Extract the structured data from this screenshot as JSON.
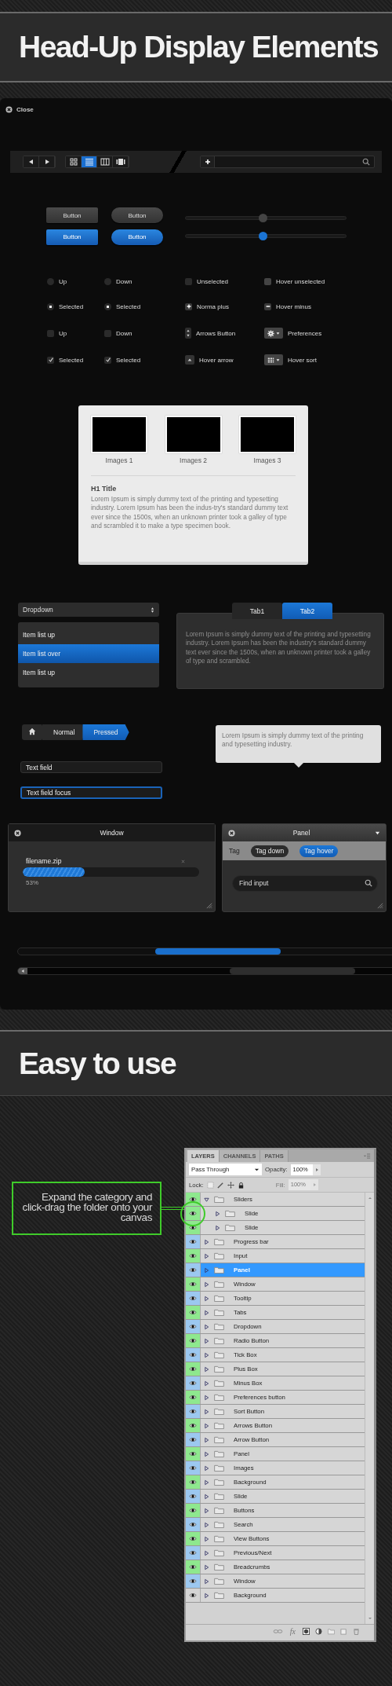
{
  "header": {
    "title": "Head-Up Display Elements"
  },
  "hud": {
    "close": "Close",
    "nav": [
      {
        "kind": "prev"
      },
      {
        "kind": "next"
      }
    ],
    "views": [
      {
        "kind": "grid",
        "selected": false
      },
      {
        "kind": "list",
        "selected": true
      },
      {
        "kind": "columns",
        "selected": false
      },
      {
        "kind": "coverflow",
        "selected": false
      }
    ],
    "buttons": [
      {
        "label": "Button",
        "kind": "square",
        "active": false
      },
      {
        "label": "Button",
        "kind": "pill",
        "active": false
      },
      {
        "label": "Button",
        "kind": "square",
        "active": true
      },
      {
        "label": "Button",
        "kind": "pill",
        "active": true
      }
    ],
    "sliders": [
      {
        "level": 0.48,
        "active": false
      },
      {
        "level": 0.48,
        "active": true
      }
    ],
    "radios": [
      {
        "label": "Up",
        "checked": false
      },
      {
        "label": "Down",
        "checked": false
      },
      {
        "label": "Selected",
        "checked": true
      },
      {
        "label": "Selected",
        "checked": true
      }
    ],
    "checkboxes": [
      {
        "label": "Up",
        "checked": false
      },
      {
        "label": "Down",
        "checked": false
      },
      {
        "label": "Selected",
        "checked": true
      },
      {
        "label": "Selected",
        "checked": true
      }
    ],
    "controls": [
      {
        "kind": "box",
        "label": "Unselected",
        "checked": false
      },
      {
        "kind": "box-hover",
        "label": "Hover unselected",
        "checked": false
      },
      {
        "kind": "plus",
        "label": "Norma plus"
      },
      {
        "kind": "minus",
        "label": "Hover minus"
      },
      {
        "kind": "arrows",
        "label": "Arrows Button"
      },
      {
        "kind": "gear",
        "label": "Preferences"
      },
      {
        "kind": "up",
        "label": "Hover arrow"
      },
      {
        "kind": "sort",
        "label": "Hover sort"
      }
    ],
    "gallery": {
      "images": [
        {
          "caption": "Images 1"
        },
        {
          "caption": "Images 2"
        },
        {
          "caption": "Images 3"
        }
      ],
      "title": "H1 Title",
      "body": "Lorem Ipsum is simply dummy text of the printing and typesetting industry. Lorem Ipsum has been the indus-try's standard dummy text ever since the 1500s, when an unknown printer took a galley of type and scrambled it to make a type specimen book."
    },
    "dropdown": {
      "value": "Dropdown",
      "items": [
        {
          "label": "Item list up",
          "selected": false
        },
        {
          "label": "Item list over",
          "selected": true
        },
        {
          "label": "Item list up",
          "selected": false
        }
      ]
    },
    "tabs": [
      {
        "label": "Tab1",
        "selected": false
      },
      {
        "label": "Tab2",
        "selected": true
      }
    ],
    "tab_body": "Lorem Ipsum is simply dummy text of the printing and typesetting industry. Lorem Ipsum has been the industry's standard dummy text ever since the 1500s, when an unknown printer took a galley of type and scrambled.",
    "breadcrumbs": [
      {
        "kind": "home",
        "selected": false
      },
      {
        "kind": "text",
        "label": "Normal",
        "selected": false
      },
      {
        "kind": "text",
        "label": "Pressed",
        "selected": true
      }
    ],
    "tooltip": "Lorem Ipsum is simply dummy text of the printing and typesetting industry.",
    "text_fields": [
      {
        "value": "Text field",
        "focused": false
      },
      {
        "value": "Text field focus",
        "focused": true
      }
    ],
    "window": {
      "title": "Window",
      "file": "filename.zip",
      "level": 0.35,
      "reading": "53%"
    },
    "panel": {
      "title": "Panel",
      "tags": [
        {
          "label": "Tag",
          "kind": "plain"
        },
        {
          "label": "Tag down",
          "kind": "down"
        },
        {
          "label": "Tag hover",
          "kind": "hover"
        }
      ],
      "search": {
        "placeholder": "Find input"
      }
    }
  },
  "section2": {
    "title": "Easy to use",
    "callout": "Expand the category and click-drag the folder onto your canvas"
  },
  "layers_panel": {
    "tabs": [
      {
        "label": "LAYERS",
        "selected": true
      },
      {
        "label": "CHANNELS",
        "selected": false
      },
      {
        "label": "PATHS",
        "selected": false
      }
    ],
    "blend_mode": "Pass Through",
    "opacity_label": "Opacity:",
    "opacity": "100%",
    "lock_label": "Lock:",
    "fill": {
      "label": "Fill:",
      "value": "100%",
      "disabled": true
    },
    "layers": [
      {
        "name": "Sliders",
        "color": "#8ee88e",
        "expanded": true,
        "selected": false,
        "children": [
          {
            "name": "Slide",
            "color": "#8ee88e",
            "expanded": false,
            "selected": false
          },
          {
            "name": "Slide",
            "color": "#8ee88e",
            "expanded": false,
            "selected": false
          }
        ]
      },
      {
        "name": "Progress bar",
        "color": "#9cc8f0",
        "expanded": false,
        "selected": false
      },
      {
        "name": "Input",
        "color": "#8ee88e",
        "expanded": false,
        "selected": false
      },
      {
        "name": "Panel",
        "color": "#9cc8f0",
        "expanded": false,
        "selected": true
      },
      {
        "name": "Window",
        "color": "#8ee88e",
        "expanded": false,
        "selected": false
      },
      {
        "name": "Tooltip",
        "color": "#9cc8f0",
        "expanded": false,
        "selected": false
      },
      {
        "name": "Tabs",
        "color": "#8ee88e",
        "expanded": false,
        "selected": false
      },
      {
        "name": "Dropdown",
        "color": "#9cc8f0",
        "expanded": false,
        "selected": false
      },
      {
        "name": "Radio Button",
        "color": "#8ee88e",
        "expanded": false,
        "selected": false
      },
      {
        "name": "Tick Box",
        "color": "#9cc8f0",
        "expanded": false,
        "selected": false
      },
      {
        "name": "Plus Box",
        "color": "#8ee88e",
        "expanded": false,
        "selected": false
      },
      {
        "name": "Minus Box",
        "color": "#9cc8f0",
        "expanded": false,
        "selected": false
      },
      {
        "name": "Preferences button",
        "color": "#8ee88e",
        "expanded": false,
        "selected": false
      },
      {
        "name": "Sort Button",
        "color": "#9cc8f0",
        "expanded": false,
        "selected": false
      },
      {
        "name": "Arrows Button",
        "color": "#8ee88e",
        "expanded": false,
        "selected": false
      },
      {
        "name": "Arrow Button",
        "color": "#9cc8f0",
        "expanded": false,
        "selected": false
      },
      {
        "name": "Panel",
        "color": "#8ee88e",
        "expanded": false,
        "selected": false
      },
      {
        "name": "Images",
        "color": "#9cc8f0",
        "expanded": false,
        "selected": false
      },
      {
        "name": "Background",
        "color": "#8ee88e",
        "expanded": false,
        "selected": false
      },
      {
        "name": "Slide",
        "color": "#9cc8f0",
        "expanded": false,
        "selected": false
      },
      {
        "name": "Buttons",
        "color": "#8ee88e",
        "expanded": false,
        "selected": false
      },
      {
        "name": "Search",
        "color": "#9cc8f0",
        "expanded": false,
        "selected": false
      },
      {
        "name": "View Buttons",
        "color": "#8ee88e",
        "expanded": false,
        "selected": false
      },
      {
        "name": "Previous/Next",
        "color": "#9cc8f0",
        "expanded": false,
        "selected": false
      },
      {
        "name": "Breadcrumbs",
        "color": "#8ee88e",
        "expanded": false,
        "selected": false
      },
      {
        "name": "Window",
        "color": "#9cc8f0",
        "expanded": false,
        "selected": false
      },
      {
        "name": "Background",
        "color": "#d4d4d4",
        "expanded": false,
        "selected": false
      }
    ],
    "fx_label": "fx"
  }
}
